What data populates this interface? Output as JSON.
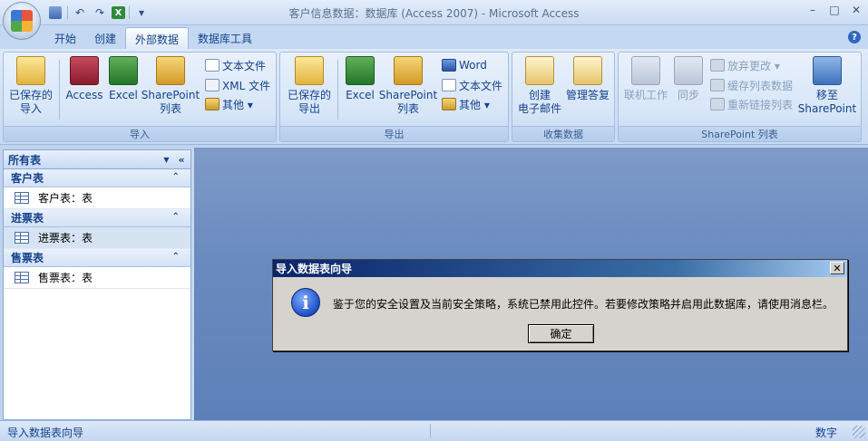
{
  "window": {
    "title": "客户信息数据：数据库 (Access 2007) - Microsoft Access",
    "controls": {
      "minimize": "–",
      "maximize": "□",
      "close": "✕"
    }
  },
  "qat": {
    "save_icon": "save-icon",
    "undo_icon": "↶",
    "redo_icon": "↷",
    "excel_icon": "X",
    "more_icon": "▾"
  },
  "tabs": [
    {
      "label": "开始"
    },
    {
      "label": "创建"
    },
    {
      "label": "外部数据"
    },
    {
      "label": "数据库工具"
    }
  ],
  "help_icon": "?",
  "ribbon": {
    "import": {
      "label": "导入",
      "saved_import": "已保存的\n导入",
      "access": "Access",
      "excel": "Excel",
      "sharepoint": "SharePoint\n列表",
      "text_file": "文本文件",
      "xml_file": "XML 文件",
      "other": "其他 ▾"
    },
    "export": {
      "label": "导出",
      "saved_export": "已保存的\n导出",
      "excel": "Excel",
      "sharepoint": "SharePoint\n列表",
      "word": "Word",
      "text_file": "文本文件",
      "other": "其他 ▾"
    },
    "collect": {
      "label": "收集数据",
      "create_email": "创建\n电子邮件",
      "manage_replies": "管理答复"
    },
    "sharepoint_lists": {
      "label": "SharePoint 列表",
      "work_online": "联机工作",
      "sync": "同步",
      "discard_changes": "放弃更改 ▾",
      "cache_list_data": "缓存列表数据",
      "relink_lists": "重新链接列表",
      "move_to_sharepoint": "移至\nSharePoint"
    }
  },
  "nav": {
    "header": "所有表",
    "dropdown_icon": "▼",
    "collapse_icon": "«",
    "groups": [
      {
        "name": "客户表",
        "chevron": "⌃",
        "item": "客户表：表"
      },
      {
        "name": "进票表",
        "chevron": "⌃",
        "item": "进票表：表"
      },
      {
        "name": "售票表",
        "chevron": "⌃",
        "item": "售票表：表"
      }
    ]
  },
  "dialog": {
    "title": "导入数据表向导",
    "close": "✕",
    "info_glyph": "i",
    "message": "鉴于您的安全设置及当前安全策略，系统已禁用此控件。若要修改策略并启用此数据库，请使用消息栏。",
    "ok": "确定"
  },
  "status": {
    "left": "导入数据表向导",
    "right": "数字"
  }
}
